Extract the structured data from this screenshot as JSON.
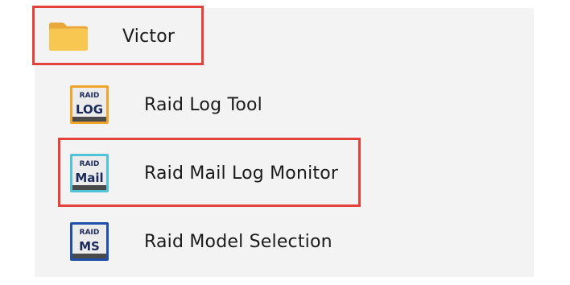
{
  "menu": {
    "folder": {
      "label": "Victor",
      "icon": "folder-icon"
    },
    "items": [
      {
        "label": "Raid Log Tool",
        "icon": "raid-log-icon",
        "icon_top": "RAID",
        "icon_main": "LOG",
        "accent": "#f2a32a"
      },
      {
        "label": "Raid Mail Log Monitor",
        "icon": "raid-mail-icon",
        "icon_top": "RAID",
        "icon_main": "Mail",
        "accent": "#4fc3d8"
      },
      {
        "label": "Raid Model Selection",
        "icon": "raid-ms-icon",
        "icon_top": "RAID",
        "icon_main": "MS",
        "accent": "#1f4fa8"
      }
    ]
  },
  "colors": {
    "highlight": "#e4413a",
    "panel_bg": "#f3f3f3",
    "folder": "#f6c04f"
  }
}
